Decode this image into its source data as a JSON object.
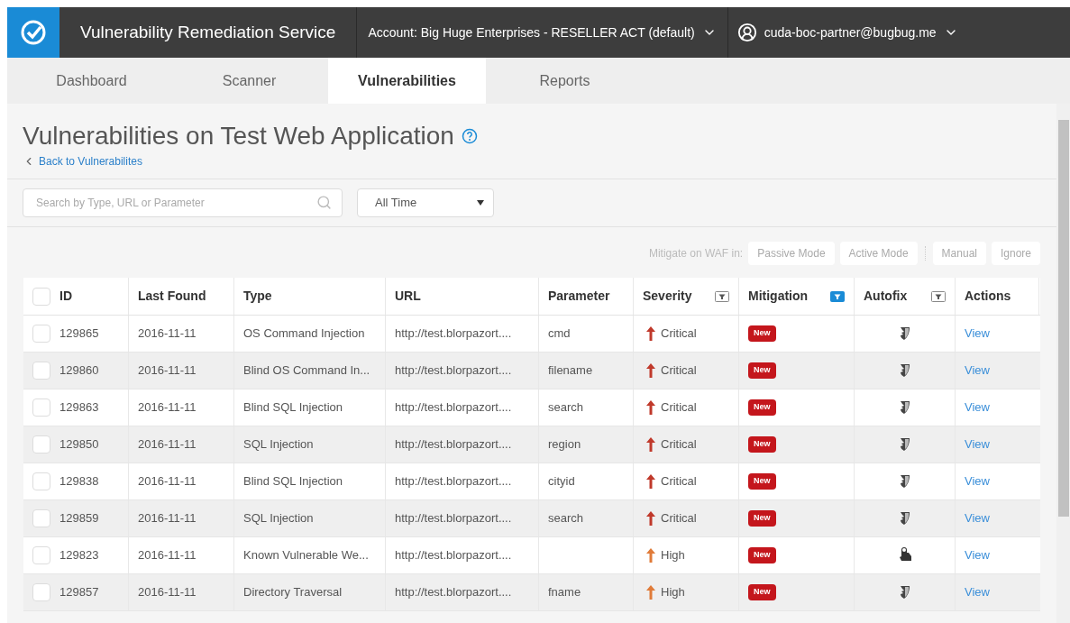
{
  "app": {
    "title": "Vulnerability Remediation Service",
    "account": "Account: Big Huge Enterprises - RESELLER ACT (default)",
    "user": "cuda-boc-partner@bugbug.me"
  },
  "tabs": [
    {
      "label": "Dashboard",
      "selected": false
    },
    {
      "label": "Scanner",
      "selected": false
    },
    {
      "label": "Vulnerabilities",
      "selected": true
    },
    {
      "label": "Reports",
      "selected": false
    }
  ],
  "page": {
    "title": "Vulnerabilities on Test Web Application",
    "back_link": "Back to Vulnerabilites"
  },
  "search": {
    "placeholder": "Search by Type, URL or Parameter"
  },
  "time_filter": {
    "value": "All Time"
  },
  "mitigate": {
    "label": "Mitigate on WAF in:",
    "buttons": [
      "Passive Mode",
      "Active Mode",
      "Manual",
      "Ignore"
    ]
  },
  "table": {
    "select_all": {
      "checked": false
    },
    "columns": [
      {
        "label": "ID"
      },
      {
        "label": "Last Found"
      },
      {
        "label": "Type"
      },
      {
        "label": "URL"
      },
      {
        "label": "Parameter"
      },
      {
        "label": "Severity",
        "filter": {
          "active": false
        }
      },
      {
        "label": "Mitigation",
        "filter": {
          "active": true
        }
      },
      {
        "label": "Autofix",
        "filter": {
          "active": false
        }
      },
      {
        "label": "Actions"
      }
    ],
    "rows": [
      {
        "checked": false,
        "id": "129865",
        "last_found": "2016-11-11",
        "type": "OS Command Injection",
        "url": "http://test.blorpazort....",
        "parameter": "cmd",
        "severity": {
          "label": "Critical",
          "color": "#c0392b"
        },
        "mitigation": "New",
        "autofix": {
          "kind": "shield"
        },
        "action": "View"
      },
      {
        "checked": false,
        "id": "129860",
        "last_found": "2016-11-11",
        "type": "Blind OS Command In...",
        "url": "http://test.blorpazort....",
        "parameter": "filename",
        "severity": {
          "label": "Critical",
          "color": "#c0392b"
        },
        "mitigation": "New",
        "autofix": {
          "kind": "shield"
        },
        "action": "View"
      },
      {
        "checked": false,
        "id": "129863",
        "last_found": "2016-11-11",
        "type": "Blind SQL Injection",
        "url": "http://test.blorpazort....",
        "parameter": "search",
        "severity": {
          "label": "Critical",
          "color": "#c0392b"
        },
        "mitigation": "New",
        "autofix": {
          "kind": "shield"
        },
        "action": "View"
      },
      {
        "checked": false,
        "id": "129850",
        "last_found": "2016-11-11",
        "type": "SQL Injection",
        "url": "http://test.blorpazort....",
        "parameter": "region",
        "severity": {
          "label": "Critical",
          "color": "#c0392b"
        },
        "mitigation": "New",
        "autofix": {
          "kind": "shield"
        },
        "action": "View"
      },
      {
        "checked": false,
        "id": "129838",
        "last_found": "2016-11-11",
        "type": "Blind SQL Injection",
        "url": "http://test.blorpazort....",
        "parameter": "cityid",
        "severity": {
          "label": "Critical",
          "color": "#c0392b"
        },
        "mitigation": "New",
        "autofix": {
          "kind": "shield"
        },
        "action": "View"
      },
      {
        "checked": false,
        "id": "129859",
        "last_found": "2016-11-11",
        "type": "SQL Injection",
        "url": "http://test.blorpazort....",
        "parameter": "search",
        "severity": {
          "label": "Critical",
          "color": "#c0392b"
        },
        "mitigation": "New",
        "autofix": {
          "kind": "shield"
        },
        "action": "View"
      },
      {
        "checked": false,
        "id": "129823",
        "last_found": "2016-11-11",
        "type": "Known Vulnerable We...",
        "url": "http://test.blorpazort....",
        "severity": {
          "label": "High",
          "color": "#e07b39"
        },
        "mitigation": "New",
        "autofix": {
          "kind": "hand"
        },
        "action": "View"
      },
      {
        "checked": false,
        "id": "129857",
        "last_found": "2016-11-11",
        "type": "Directory Traversal",
        "url": "http://test.blorpazort....",
        "parameter": "fname",
        "severity": {
          "label": "High",
          "color": "#e07b39"
        },
        "mitigation": "New",
        "autofix": {
          "kind": "shield"
        },
        "action": "View"
      }
    ]
  }
}
